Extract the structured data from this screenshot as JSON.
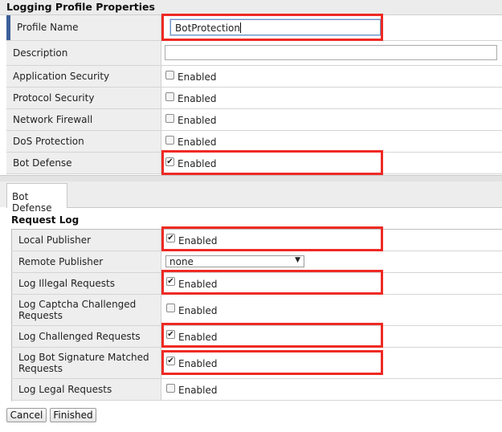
{
  "header": {
    "title": "Logging Profile Properties"
  },
  "profile": {
    "name_label": "Profile Name",
    "name_value": "BotProtection",
    "description_label": "Description",
    "description_value": "",
    "rows": [
      {
        "label": "Application Security",
        "option": "Enabled",
        "checked": false
      },
      {
        "label": "Protocol Security",
        "option": "Enabled",
        "checked": false
      },
      {
        "label": "Network Firewall",
        "option": "Enabled",
        "checked": false
      },
      {
        "label": "DoS Protection",
        "option": "Enabled",
        "checked": false
      },
      {
        "label": "Bot Defense",
        "option": "Enabled",
        "checked": true
      }
    ]
  },
  "tabs": [
    {
      "label": "Bot Defense"
    }
  ],
  "request_log": {
    "heading": "Request Log",
    "local_publisher": {
      "label": "Local Publisher",
      "option": "Enabled",
      "checked": true
    },
    "remote_publisher": {
      "label": "Remote Publisher",
      "selected": "none"
    },
    "log_illegal": {
      "label": "Log Illegal Requests",
      "option": "Enabled",
      "checked": true
    },
    "log_captcha": {
      "label_line1": "Log Captcha Challenged",
      "label_line2": "Requests",
      "option": "Enabled",
      "checked": false
    },
    "log_challenged": {
      "label": "Log Challenged Requests",
      "option": "Enabled",
      "checked": true
    },
    "log_bot_signature": {
      "label_line1": "Log Bot Signature Matched",
      "label_line2": "Requests",
      "option": "Enabled",
      "checked": true
    },
    "log_legal": {
      "label": "Log Legal Requests",
      "option": "Enabled",
      "checked": false
    }
  },
  "buttons": {
    "cancel": "Cancel",
    "finished": "Finished"
  },
  "colors": {
    "highlight": "#ee2a24",
    "label_bg": "#eeeeee",
    "accent_bar": "#3b5f9a"
  }
}
